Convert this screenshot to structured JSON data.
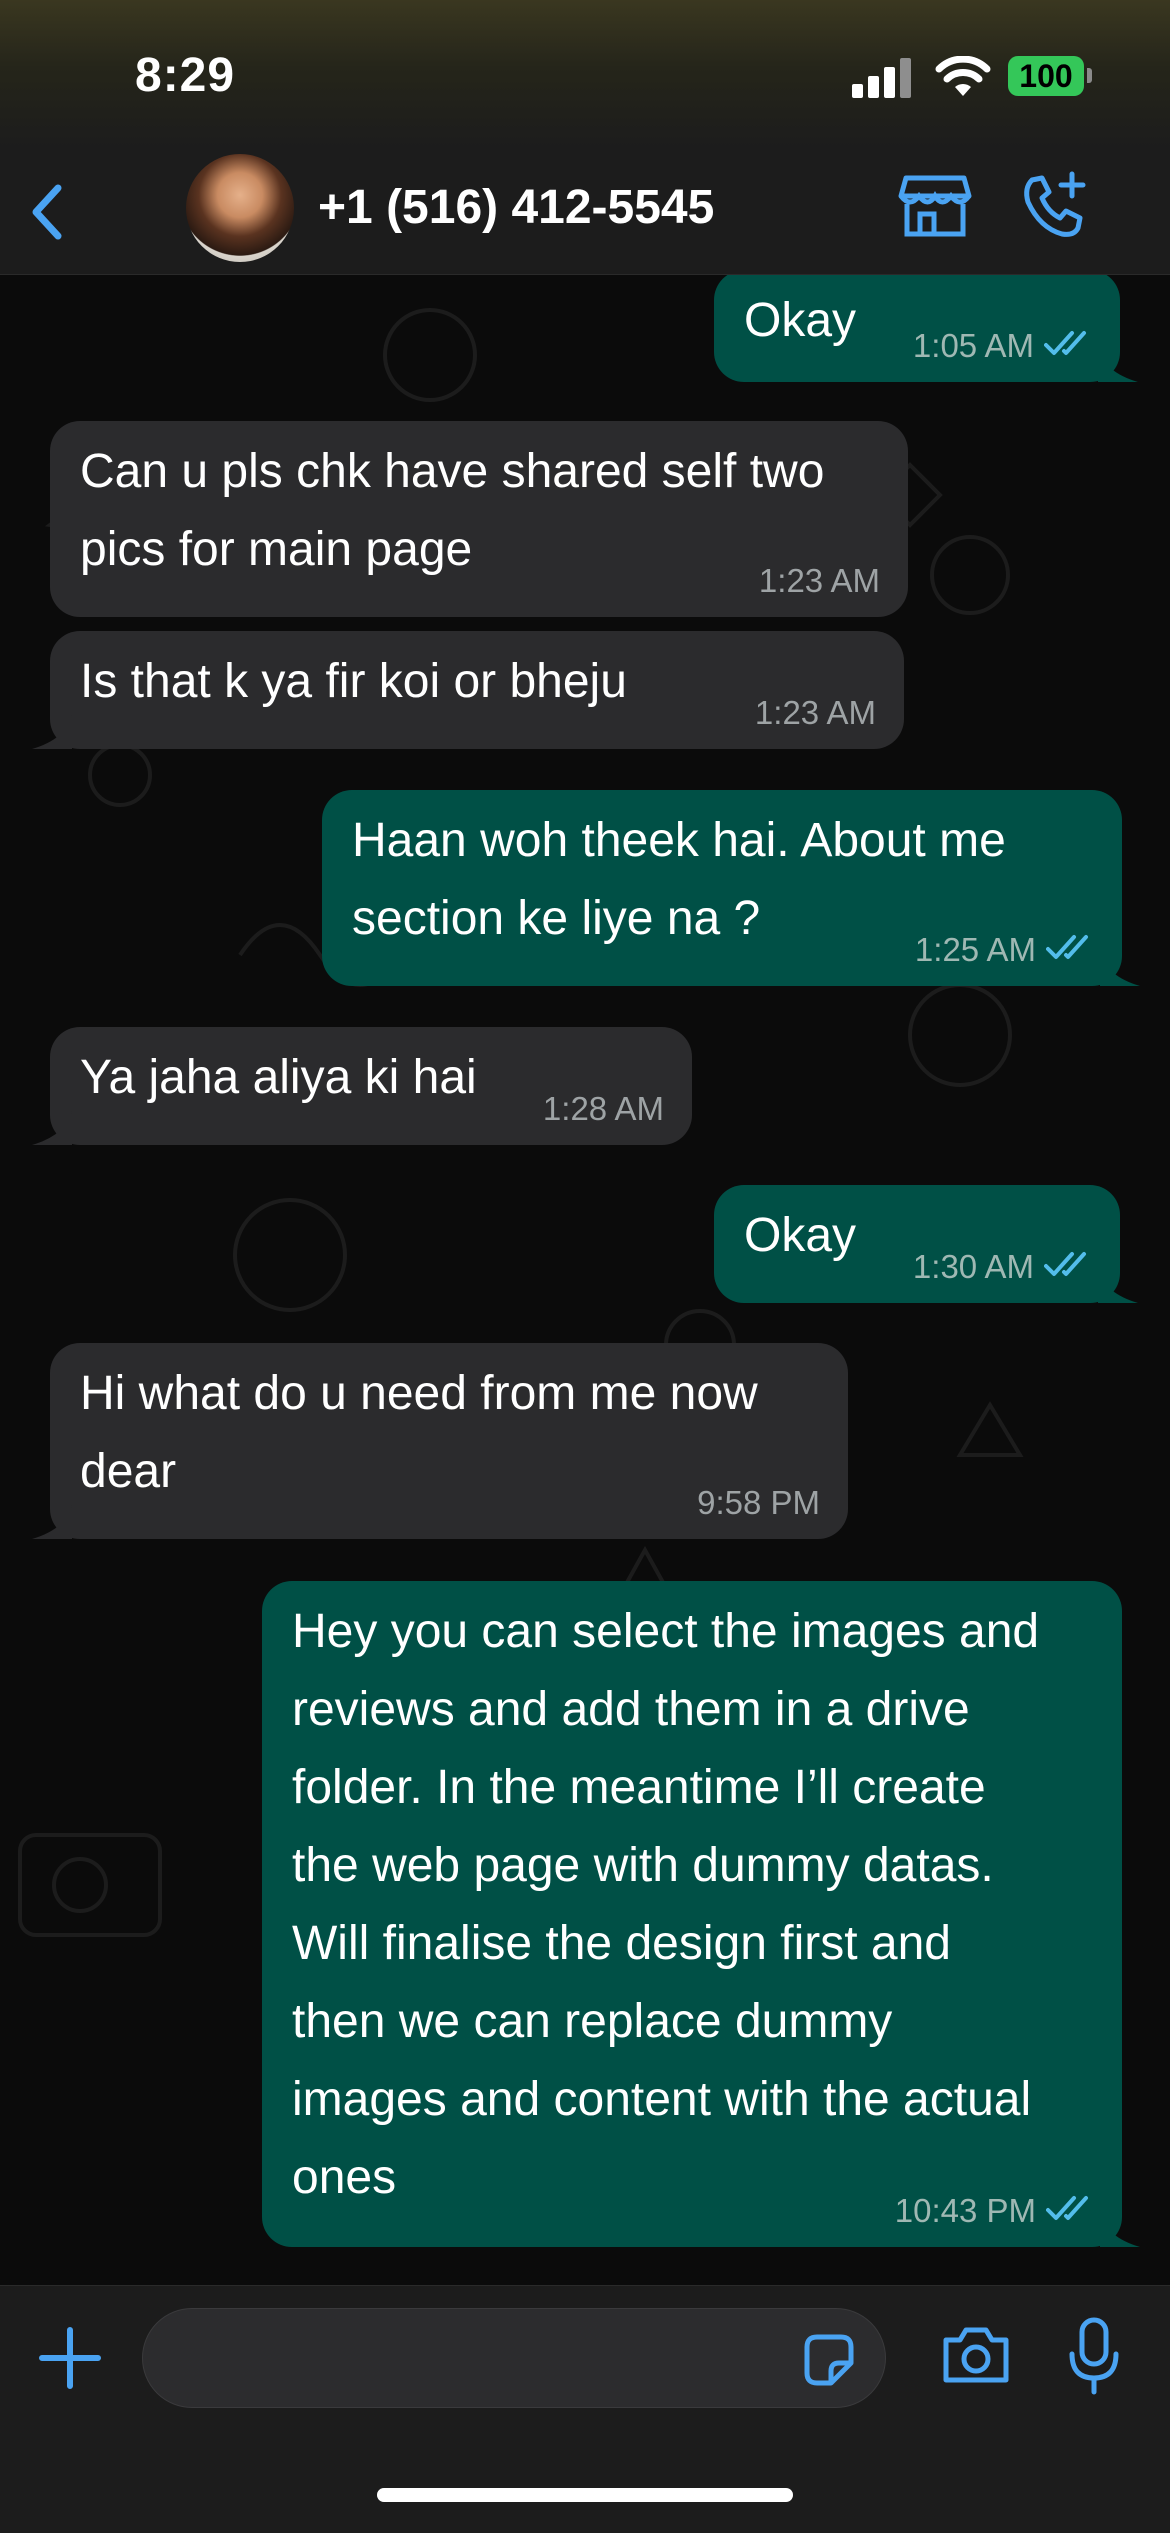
{
  "status_bar": {
    "time": "8:29",
    "battery": "100"
  },
  "header": {
    "back_icon": "chevron-left-icon",
    "contact_name": "+1 (516) 412-5545",
    "accent_color": "#4aa3f2"
  },
  "messages": [
    {
      "direction": "out",
      "text": "Okay",
      "time": "1:05 AM",
      "read": true
    },
    {
      "direction": "in",
      "text": "Can u pls chk have shared self two\npics for main page",
      "time": "1:23 AM"
    },
    {
      "direction": "in",
      "text": "Is that k ya fir koi or bheju",
      "time": "1:23 AM"
    },
    {
      "direction": "out",
      "text": "Haan woh theek hai. About me\nsection ke liye na ?",
      "time": "1:25 AM",
      "read": true
    },
    {
      "direction": "in",
      "text": "Ya jaha aliya ki hai",
      "time": "1:28 AM"
    },
    {
      "direction": "out",
      "text": "Okay",
      "time": "1:30 AM",
      "read": true
    },
    {
      "direction": "in",
      "text": "Hi what do u need from me now\ndear",
      "time": "9:58 PM"
    },
    {
      "direction": "out",
      "text": "Hey you can select the images and\nreviews and add them in a drive\nfolder. In the meantime I’ll create\nthe web page with dummy datas.\nWill finalise the design first and\nthen we can replace dummy\nimages and content with the actual\nones",
      "time": "10:43 PM",
      "read": true
    }
  ],
  "colors": {
    "incoming_bubble": "#2b2b2d",
    "outgoing_bubble": "#005046",
    "read_ticks": "#53bdeb"
  },
  "composer": {
    "input_value": ""
  }
}
